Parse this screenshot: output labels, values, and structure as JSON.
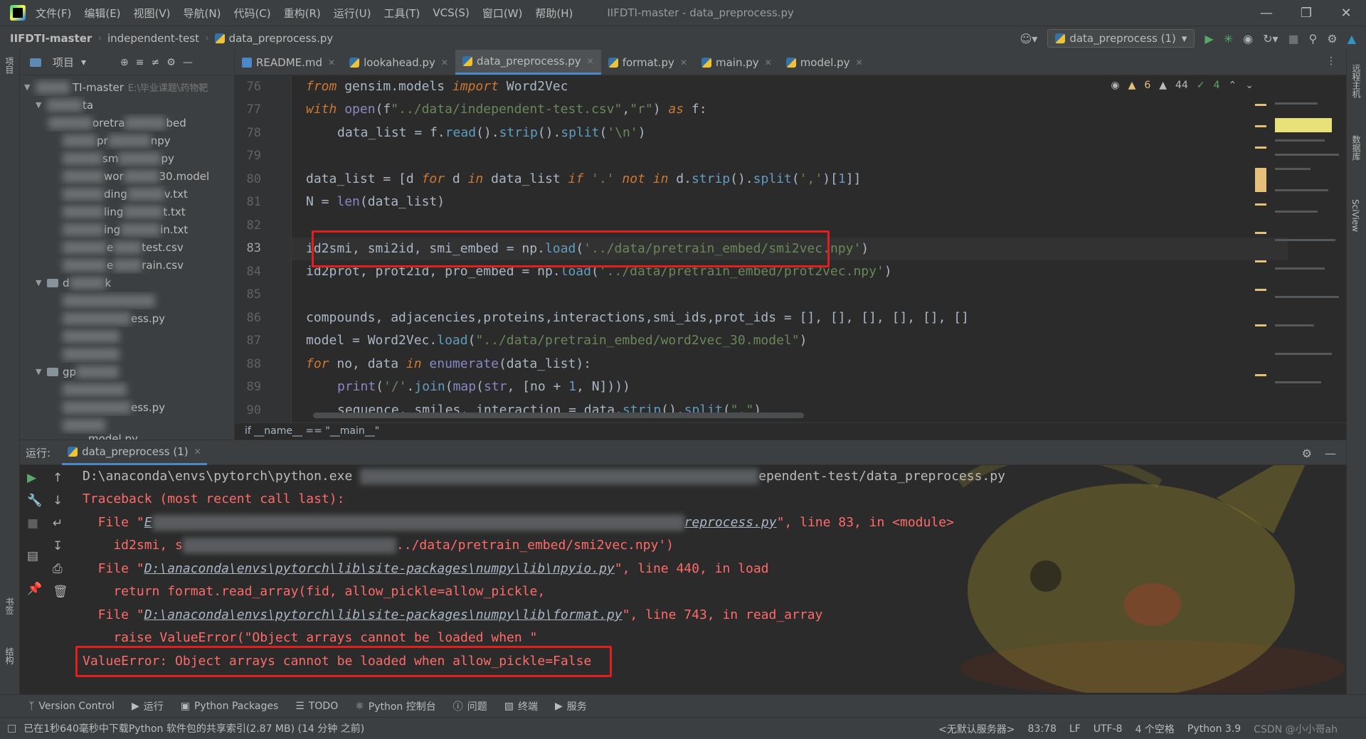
{
  "menubar": {
    "items": [
      "文件(F)",
      "编辑(E)",
      "视图(V)",
      "导航(N)",
      "代码(C)",
      "重构(R)",
      "运行(U)",
      "工具(T)",
      "VCS(S)",
      "窗口(W)",
      "帮助(H)"
    ],
    "window_title": "IIFDTI-master - data_preprocess.py"
  },
  "navbar": {
    "crumbs": [
      "IIFDTI-master",
      "independent-test",
      "data_preprocess.py"
    ],
    "run_config": "data_preprocess (1)"
  },
  "strips": {
    "left_top": "项目",
    "left_bottom1": "书签",
    "left_bottom2": "结构",
    "right1": "远程主机",
    "right2": "数据库",
    "right3": "SciView"
  },
  "project": {
    "title": "项目",
    "root_name": "TI-master",
    "root_path": "E:\\毕业课题\\药物靶",
    "rows": [
      "ta",
      "oretra",
      "bed",
      "pr",
      "npy",
      "sm",
      "py",
      "wor",
      "30.model",
      "ding",
      "v.txt",
      "ling",
      "t.txt",
      "ing",
      "in.txt",
      "e",
      "test.csv",
      "e",
      "rain.csv",
      "d",
      "k",
      "ess.py",
      "gp",
      "ess.py",
      "model.py"
    ]
  },
  "tabs": [
    {
      "label": "README.md"
    },
    {
      "label": "lookahead.py"
    },
    {
      "label": "data_preprocess.py"
    },
    {
      "label": "format.py"
    },
    {
      "label": "main.py"
    },
    {
      "label": "model.py"
    }
  ],
  "inspection": {
    "warnings": "6",
    "weak": "44",
    "ok": "4"
  },
  "code": {
    "line_numbers": [
      "76",
      "77",
      "78",
      "79",
      "80",
      "81",
      "82",
      "83",
      "84",
      "85",
      "86",
      "87",
      "88",
      "89",
      "90"
    ],
    "l76": [
      "from",
      " gensim.models ",
      "import",
      " Word2Vec"
    ],
    "l77": [
      "with",
      " ",
      "open",
      "(f",
      "\"../data/independent-test.csv\"",
      ",",
      "\"r\"",
      ") ",
      "as",
      " f:"
    ],
    "l78": [
      "data_list = f.",
      "read",
      "().",
      "strip",
      "().",
      "split",
      "(",
      "'\\n'",
      ")"
    ],
    "l80": [
      "data_list = [d ",
      "for",
      " d ",
      "in",
      " data_list ",
      "if",
      " ",
      "'.'",
      " ",
      "not in",
      " d.",
      "strip",
      "().",
      "split",
      "(",
      "','",
      ")[",
      "1",
      "]]"
    ],
    "l81": [
      "N = ",
      "len",
      "(data_list)"
    ],
    "l83": [
      "id2smi, smi2id, smi_embed = np.",
      "load",
      "(",
      "'../data/pretrain_embed/smi2vec.npy'",
      ")"
    ],
    "l84": [
      "id2prot, prot2id, pro_embed = np.",
      "load",
      "(",
      "'../data/pretrain_embed/prot2vec.npy'",
      ")"
    ],
    "l86": [
      "compounds, adjacencies,proteins,interactions,smi_ids,prot_ids = [], [], [], [], [], []"
    ],
    "l87": [
      "model = Word2Vec.",
      "load",
      "(",
      "\"../data/pretrain_embed/word2vec_30.model\"",
      ")"
    ],
    "l88": [
      "for",
      " no, data ",
      "in",
      " ",
      "enumerate",
      "(data_list):"
    ],
    "l89": [
      "print",
      "(",
      "'/'",
      ".",
      "join",
      "(",
      "map",
      "(",
      "str",
      ", [no + ",
      "1",
      ", N])))"
    ],
    "l90": [
      "sequence, smiles, interaction = data.",
      "strip",
      "().",
      "split",
      "(",
      "\",\"",
      ")"
    ],
    "breadcrumb": "if __name__ == \"__main__\""
  },
  "run": {
    "label": "运行:",
    "tab": "data_preprocess (1)",
    "lines": {
      "c1": "D:\\anaconda\\envs\\pytorch\\python.exe",
      "c1_tail": "ependent-test/data_preprocess.py",
      "c2": "Traceback (most recent call last):",
      "c3_head": "  File \"",
      "c3_link_head": "E",
      "c3_link_tail": "reprocess.py",
      "c3_tail": "\", line 83, in <module>",
      "c4_head": "    id2smi, s",
      "c4_tail": "../data/pretrain_embed/smi2vec.npy')",
      "c5_head": "  File \"",
      "c5_link": "D:\\anaconda\\envs\\pytorch\\lib\\site-packages\\numpy\\lib\\npyio.py",
      "c5_tail": "\", line 440, in load",
      "c6": "    return format.read_array(fid, allow_pickle=allow_pickle,",
      "c7_head": "  File \"",
      "c7_link": "D:\\anaconda\\envs\\pytorch\\lib\\site-packages\\numpy\\lib\\format.py",
      "c7_tail": "\", line 743, in read_array",
      "c8": "    raise ValueError(\"Object arrays cannot be loaded when \"",
      "c9": "ValueError: Object arrays cannot be loaded when allow_pickle=False"
    }
  },
  "bottom_tools": [
    "Version Control",
    "运行",
    "Python Packages",
    "TODO",
    "Python 控制台",
    "问题",
    "终端",
    "服务"
  ],
  "status": {
    "message": "已在1秒640毫秒中下载Python 软件包的共享索引(2.87 MB) (14 分钟 之前)",
    "server": "<无默认服务器>",
    "position": "83:78",
    "line_sep": "LF",
    "encoding": "UTF-8",
    "indent": "4 个空格",
    "interpreter": "Python 3.9",
    "watermark": "CSDN @小小哥ah"
  },
  "colors": {
    "accent": "#4a88c7",
    "error": "#ff6b68",
    "highlight_box": "#e01f1f"
  }
}
